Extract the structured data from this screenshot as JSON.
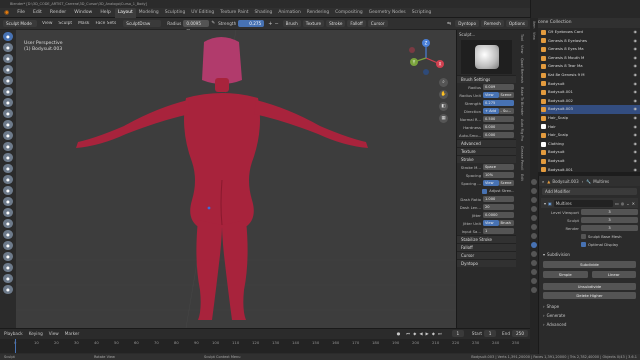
{
  "window": {
    "title": "Blender* [D:\\3D_CODE_ARTIST_Carrera\\3D_Cursor\\3D_Analogo\\Curso_1_Body]",
    "controls": [
      "—",
      "❐",
      "✕"
    ]
  },
  "menubar": {
    "menus": [
      "File",
      "Edit",
      "Render",
      "Window",
      "Help"
    ],
    "workspaces": [
      "Layout",
      "Modeling",
      "Sculpting",
      "UV Editing",
      "Texture Paint",
      "Shading",
      "Animation",
      "Rendering",
      "Compositing",
      "Geometry Nodes",
      "Scripting"
    ],
    "active_workspace": "Layout",
    "scene": "Scene",
    "view_layer": "ViewLayer"
  },
  "header": {
    "mode": "Sculpt Mode",
    "menus": [
      "View",
      "Sculpt",
      "Mask",
      "Face Sets"
    ],
    "brush_name": "SculptDraw",
    "radius_label": "Radius",
    "radius_value": "0.0095 m",
    "strength_label": "Strength",
    "strength_value": "0.275",
    "dropdowns": [
      "Brush",
      "Texture",
      "Stroke",
      "Falloff",
      "Cursor"
    ],
    "right_items": [
      "Dyntopo",
      "Remesh",
      "Options"
    ]
  },
  "viewport": {
    "view_name": "User Perspective",
    "object_label": "(1) Bodysuit.003",
    "gizmo_axes": [
      "X",
      "Y",
      "Z"
    ],
    "body_color": "#a8233c",
    "background_color": "#3d3d3d"
  },
  "npanel": {
    "brush_preview_label": "Sculpt...",
    "brush_settings_title": "Brush Settings",
    "rows": [
      {
        "label": "Radius",
        "value": "0.009",
        "blue": false
      },
      {
        "label": "Radius Unit",
        "value": "View",
        "value2": "Scene",
        "blue": true
      },
      {
        "label": "Strength",
        "value": "0.275",
        "blue": true
      },
      {
        "label": "Direction",
        "value": "+ Add",
        "value2": "- Su...",
        "blue": true
      },
      {
        "label": "Normal R...",
        "value": "0.500",
        "blue": false
      },
      {
        "label": "Hardness",
        "value": "0.000",
        "blue": false
      },
      {
        "label": "Auto-Smo...",
        "value": "0.000",
        "blue": false
      }
    ],
    "sections": [
      "Advanced",
      "Texture",
      "Stroke"
    ],
    "stroke_rows": [
      {
        "label": "Stroke M...",
        "value": "Space"
      },
      {
        "label": "Spacing",
        "value": "10%"
      },
      {
        "label": "Spacing ...",
        "value": "View",
        "value2": "Scene"
      },
      {
        "label": "",
        "value": "Adjust Stren..."
      },
      {
        "label": "Dash Ratio",
        "value": "1.000"
      },
      {
        "label": "Dash Len...",
        "value": "20"
      },
      {
        "label": "Jitter",
        "value": "0.0000"
      },
      {
        "label": "Jitter Unit",
        "value": "View",
        "value2": "Brush"
      },
      {
        "label": "Input Sa...",
        "value": "1"
      }
    ],
    "bottom_sections": [
      "Stabilize Stroke",
      "Falloff",
      "Cursor",
      "Dyntopo"
    ],
    "side_tabs": [
      "Tool",
      "View",
      "Quad Remesh",
      "Bake To Blender",
      "Auto Rig Pro",
      "Grease Pencil",
      "Edit",
      "RetopoFlow",
      "Sketch"
    ]
  },
  "outliner": {
    "header": "Scene Collection",
    "items": [
      {
        "name": "G9 Eyebrows Card",
        "color": "#e39b3e"
      },
      {
        "name": "Genesis 8 Eyelashes",
        "color": "#e39b3e"
      },
      {
        "name": "Genesis 8 Eyes Ma",
        "color": "#e39b3e"
      },
      {
        "name": "Genesis 8 Mouth M",
        "color": "#e39b3e"
      },
      {
        "name": "Genesis 8 Tear Ma",
        "color": "#e39b3e"
      },
      {
        "name": "Kat 8e Genesis 9 M",
        "color": "#e39b3e"
      },
      {
        "name": "Bodysuit",
        "color": "#e39b3e"
      },
      {
        "name": "Bodysuit.001",
        "color": "#e39b3e"
      },
      {
        "name": "Bodysuit.002",
        "color": "#e39b3e"
      },
      {
        "name": "Bodysuit.003",
        "color": "#e39b3e"
      },
      {
        "name": "Hair_Scalp",
        "color": "#e39b3e"
      },
      {
        "name": "Hair",
        "color": "#ffffff"
      },
      {
        "name": "Hair_Scalp",
        "color": "#e39b3e"
      },
      {
        "name": "Clothing",
        "color": "#ffffff"
      },
      {
        "name": "Bodysuit",
        "color": "#e39b3e"
      },
      {
        "name": "Bodysuit",
        "color": "#e39b3e"
      },
      {
        "name": "Bodysuit.001",
        "color": "#e39b3e"
      },
      {
        "name": "Bodysuit.002",
        "color": "#e39b3e"
      },
      {
        "name": "Bodysuit.003",
        "color": "#e39b3e"
      }
    ]
  },
  "properties": {
    "object_name": "Bodysuit.003",
    "modifier_tab": "Multires",
    "add_modifier": "Add Modifier",
    "modifier_name": "Multires",
    "rows": [
      {
        "label": "Level Viewport",
        "value": "3"
      },
      {
        "label": "Sculpt",
        "value": "3"
      },
      {
        "label": "Render",
        "value": "3"
      }
    ],
    "checks": [
      "Sculpt Base Mesh",
      "Optimal Display"
    ],
    "subdivision_title": "Subdivision",
    "subdivide_btn": "Subdivide",
    "simple_btn": "Simple",
    "linear_btn": "Linear",
    "unsubdivide_btn": "Unsubdivide",
    "delete_higher_btn": "Delete Higher",
    "sections": [
      "Shape",
      "Generate",
      "Advanced"
    ]
  },
  "timeline": {
    "menus": [
      "Playback",
      "Keying",
      "View",
      "Marker"
    ],
    "current_frame": "1",
    "start_label": "Start",
    "start": "1",
    "end_label": "End",
    "end": "250",
    "ticks": [
      "0",
      "10",
      "20",
      "30",
      "40",
      "50",
      "60",
      "70",
      "80",
      "90",
      "100",
      "110",
      "120",
      "130",
      "140",
      "150",
      "160",
      "170",
      "180",
      "190",
      "200",
      "210",
      "220",
      "230",
      "240",
      "250"
    ]
  },
  "statusbar": {
    "left": "Sculpt",
    "middle": "Rotate View",
    "right": "Sculpt Context Menu",
    "stats": "Bodysuit.003 | Verts 1,391,20000 | Faces 1,391,20000 | Tris 2,782,40000 | Objects 0/43 | 3.6.1"
  }
}
